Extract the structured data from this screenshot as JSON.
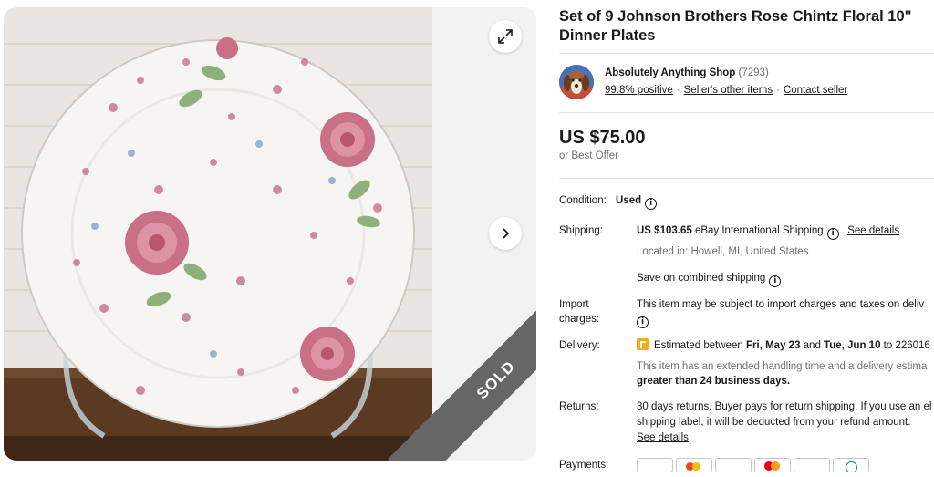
{
  "gallery": {
    "photo_alt": "Johnson Brothers Rose Chintz floral dinner plate on stand",
    "sold_label": "SOLD",
    "expand_icon": "expand-icon",
    "next_icon": "chevron-right-icon"
  },
  "listing": {
    "title_line1": "Set of 9 Johnson Brothers Rose Chintz Floral 10\"",
    "title_line2": "Dinner Plates"
  },
  "seller": {
    "name": "Absolutely Anything Shop",
    "count": "(7293)",
    "positive": "99.8% positive",
    "other_items": "Seller's other items",
    "contact": "Contact seller"
  },
  "price": {
    "amount": "US $75.00",
    "best_offer": "or Best Offer"
  },
  "details": {
    "condition_label": "Condition:",
    "condition_value": "Used",
    "shipping_label": "Shipping:",
    "shipping_price": "US $103.65",
    "shipping_method": "eBay International Shipping",
    "shipping_see_details": "See details",
    "located_in": "Located in: Howell, MI, United States",
    "combined_shipping": "Save on combined shipping",
    "import_label_1": "Import",
    "import_label_2": "charges:",
    "import_text": "This item may be subject to import charges and taxes on deliv",
    "delivery_label": "Delivery:",
    "delivery_prefix": "Estimated between ",
    "delivery_from": "Fri, May 23",
    "delivery_and": " and ",
    "delivery_to": "Tue, Jun 10",
    "delivery_zip": " to 226016",
    "handling_line1": "This item has an extended handling time and a delivery estima",
    "handling_line2": "greater than 24 business days.",
    "returns_label": "Returns:",
    "returns_line1": "30 days returns. Buyer pays for return shipping. If you use an el",
    "returns_line2": "shipping label, it will be deducted from your refund amount.",
    "returns_see_details": "See details",
    "payments_label": "Payments:"
  },
  "colors": {
    "accent_orange": "#f5a623",
    "sold_ribbon": "#666666",
    "text_primary": "#191919",
    "text_muted": "#707070"
  }
}
